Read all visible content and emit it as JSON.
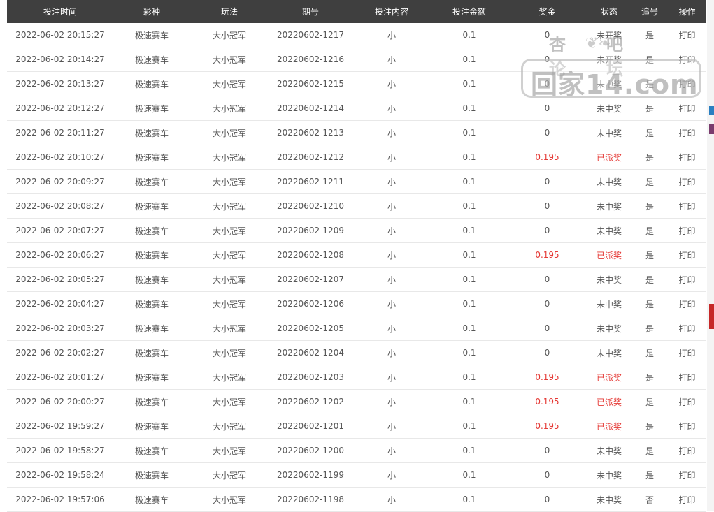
{
  "headers": [
    "投注时间",
    "彩种",
    "玩法",
    "期号",
    "投注内容",
    "投注金额",
    "奖金",
    "状态",
    "追号",
    "操作"
  ],
  "rows": [
    [
      "2022-06-02 20:15:27",
      "极速赛车",
      "大小冠军",
      "20220602-1217",
      "小",
      "0.1",
      "0",
      "未开奖",
      "是",
      "打印"
    ],
    [
      "2022-06-02 20:14:27",
      "极速赛车",
      "大小冠军",
      "20220602-1216",
      "小",
      "0.1",
      "0",
      "未开奖",
      "是",
      "打印"
    ],
    [
      "2022-06-02 20:13:27",
      "极速赛车",
      "大小冠军",
      "20220602-1215",
      "小",
      "0.1",
      "0",
      "未中奖",
      "是",
      "打印"
    ],
    [
      "2022-06-02 20:12:27",
      "极速赛车",
      "大小冠军",
      "20220602-1214",
      "小",
      "0.1",
      "0",
      "未中奖",
      "是",
      "打印"
    ],
    [
      "2022-06-02 20:11:27",
      "极速赛车",
      "大小冠军",
      "20220602-1213",
      "小",
      "0.1",
      "0",
      "未中奖",
      "是",
      "打印"
    ],
    [
      "2022-06-02 20:10:27",
      "极速赛车",
      "大小冠军",
      "20220602-1212",
      "小",
      "0.1",
      "0.195",
      "已派奖",
      "是",
      "打印"
    ],
    [
      "2022-06-02 20:09:27",
      "极速赛车",
      "大小冠军",
      "20220602-1211",
      "小",
      "0.1",
      "0",
      "未中奖",
      "是",
      "打印"
    ],
    [
      "2022-06-02 20:08:27",
      "极速赛车",
      "大小冠军",
      "20220602-1210",
      "小",
      "0.1",
      "0",
      "未中奖",
      "是",
      "打印"
    ],
    [
      "2022-06-02 20:07:27",
      "极速赛车",
      "大小冠军",
      "20220602-1209",
      "小",
      "0.1",
      "0",
      "未中奖",
      "是",
      "打印"
    ],
    [
      "2022-06-02 20:06:27",
      "极速赛车",
      "大小冠军",
      "20220602-1208",
      "小",
      "0.1",
      "0.195",
      "已派奖",
      "是",
      "打印"
    ],
    [
      "2022-06-02 20:05:27",
      "极速赛车",
      "大小冠军",
      "20220602-1207",
      "小",
      "0.1",
      "0",
      "未中奖",
      "是",
      "打印"
    ],
    [
      "2022-06-02 20:04:27",
      "极速赛车",
      "大小冠军",
      "20220602-1206",
      "小",
      "0.1",
      "0",
      "未中奖",
      "是",
      "打印"
    ],
    [
      "2022-06-02 20:03:27",
      "极速赛车",
      "大小冠军",
      "20220602-1205",
      "小",
      "0.1",
      "0",
      "未中奖",
      "是",
      "打印"
    ],
    [
      "2022-06-02 20:02:27",
      "极速赛车",
      "大小冠军",
      "20220602-1204",
      "小",
      "0.1",
      "0",
      "未中奖",
      "是",
      "打印"
    ],
    [
      "2022-06-02 20:01:27",
      "极速赛车",
      "大小冠军",
      "20220602-1203",
      "小",
      "0.1",
      "0.195",
      "已派奖",
      "是",
      "打印"
    ],
    [
      "2022-06-02 20:00:27",
      "极速赛车",
      "大小冠军",
      "20220602-1202",
      "小",
      "0.1",
      "0.195",
      "已派奖",
      "是",
      "打印"
    ],
    [
      "2022-06-02 19:59:27",
      "极速赛车",
      "大小冠军",
      "20220602-1201",
      "小",
      "0.1",
      "0.195",
      "已派奖",
      "是",
      "打印"
    ],
    [
      "2022-06-02 19:58:27",
      "极速赛车",
      "大小冠军",
      "20220602-1200",
      "小",
      "0.1",
      "0",
      "未中奖",
      "是",
      "打印"
    ],
    [
      "2022-06-02 19:58:24",
      "极速赛车",
      "大小冠军",
      "20220602-1199",
      "小",
      "0.1",
      "0",
      "未中奖",
      "是",
      "打印"
    ],
    [
      "2022-06-02 19:57:06",
      "极速赛车",
      "大小冠军",
      "20220602-1198",
      "小",
      "0.1",
      "0",
      "未中奖",
      "否",
      "打印"
    ]
  ],
  "highlight_status": "已派奖",
  "colors": {
    "header_bg": "#3f3f3f",
    "win_red": "#e53935",
    "text": "#555555"
  },
  "watermark": {
    "top_left": "杏吧",
    "top_right": "论坛",
    "main": "回家14.com"
  }
}
